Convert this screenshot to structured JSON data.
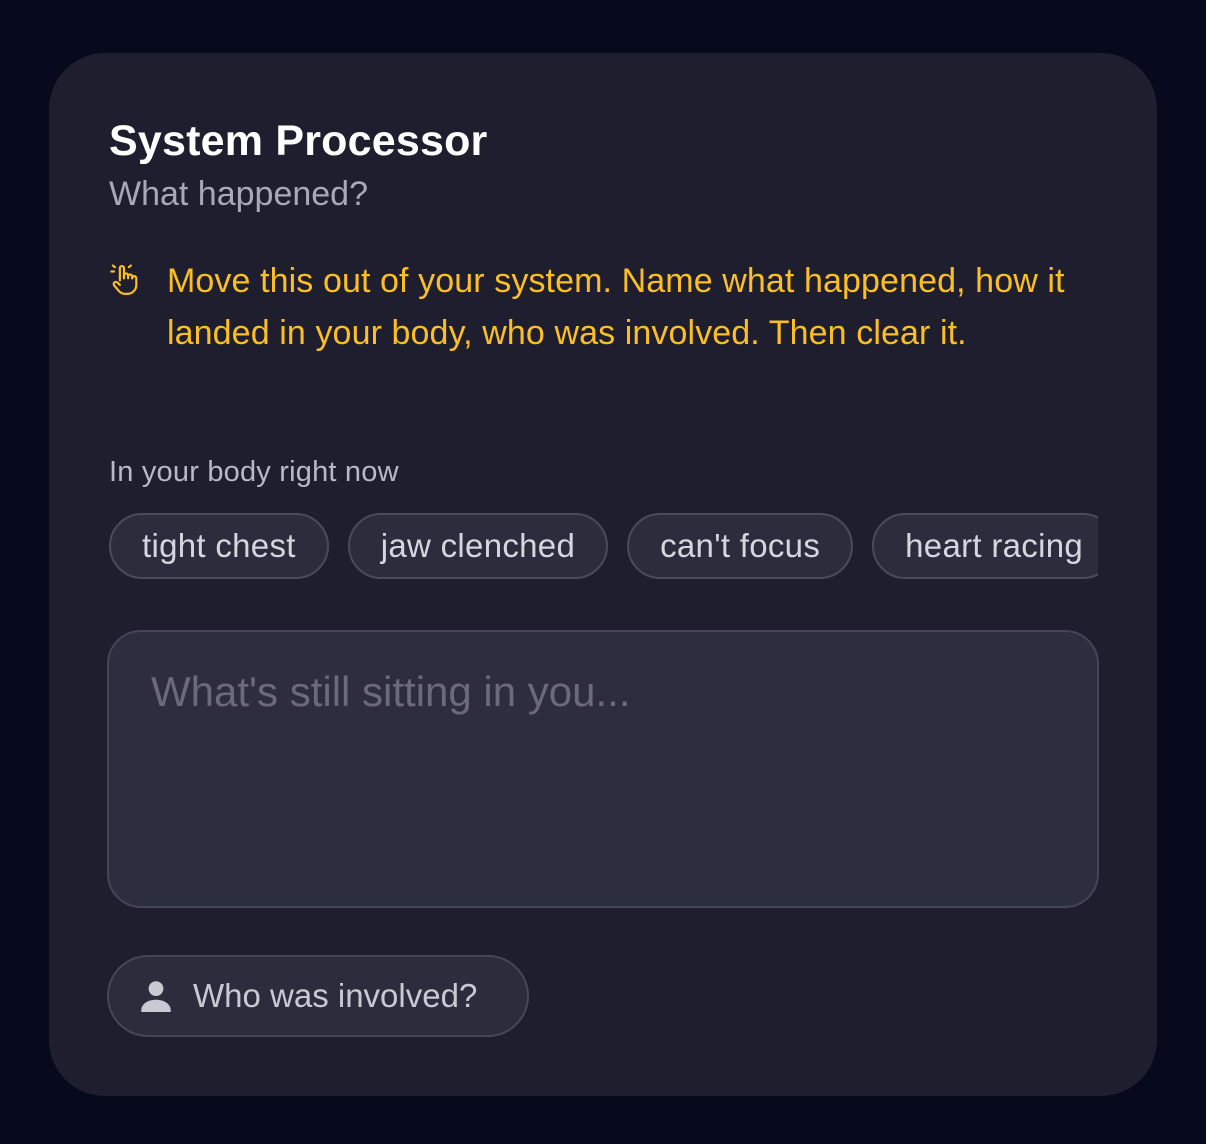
{
  "card": {
    "title": "System Processor",
    "subtitle": "What happened?"
  },
  "notice": {
    "icon": "pointing-hand-icon",
    "text": "Move this out of your system. Name what happened, how it landed in your body, who was involved. Then clear it."
  },
  "body_section": {
    "label": "In your body right now",
    "chips": [
      {
        "label": "tight chest"
      },
      {
        "label": "jaw clenched"
      },
      {
        "label": "can't focus"
      },
      {
        "label": "heart racing"
      }
    ]
  },
  "journal": {
    "value": "",
    "placeholder": "What's still sitting in you..."
  },
  "who_button": {
    "icon": "person-icon",
    "label": "Who was involved?"
  },
  "colors": {
    "page_background": "#070a1c",
    "card_background": "#1e1e2e",
    "accent": "#fbbf24"
  }
}
